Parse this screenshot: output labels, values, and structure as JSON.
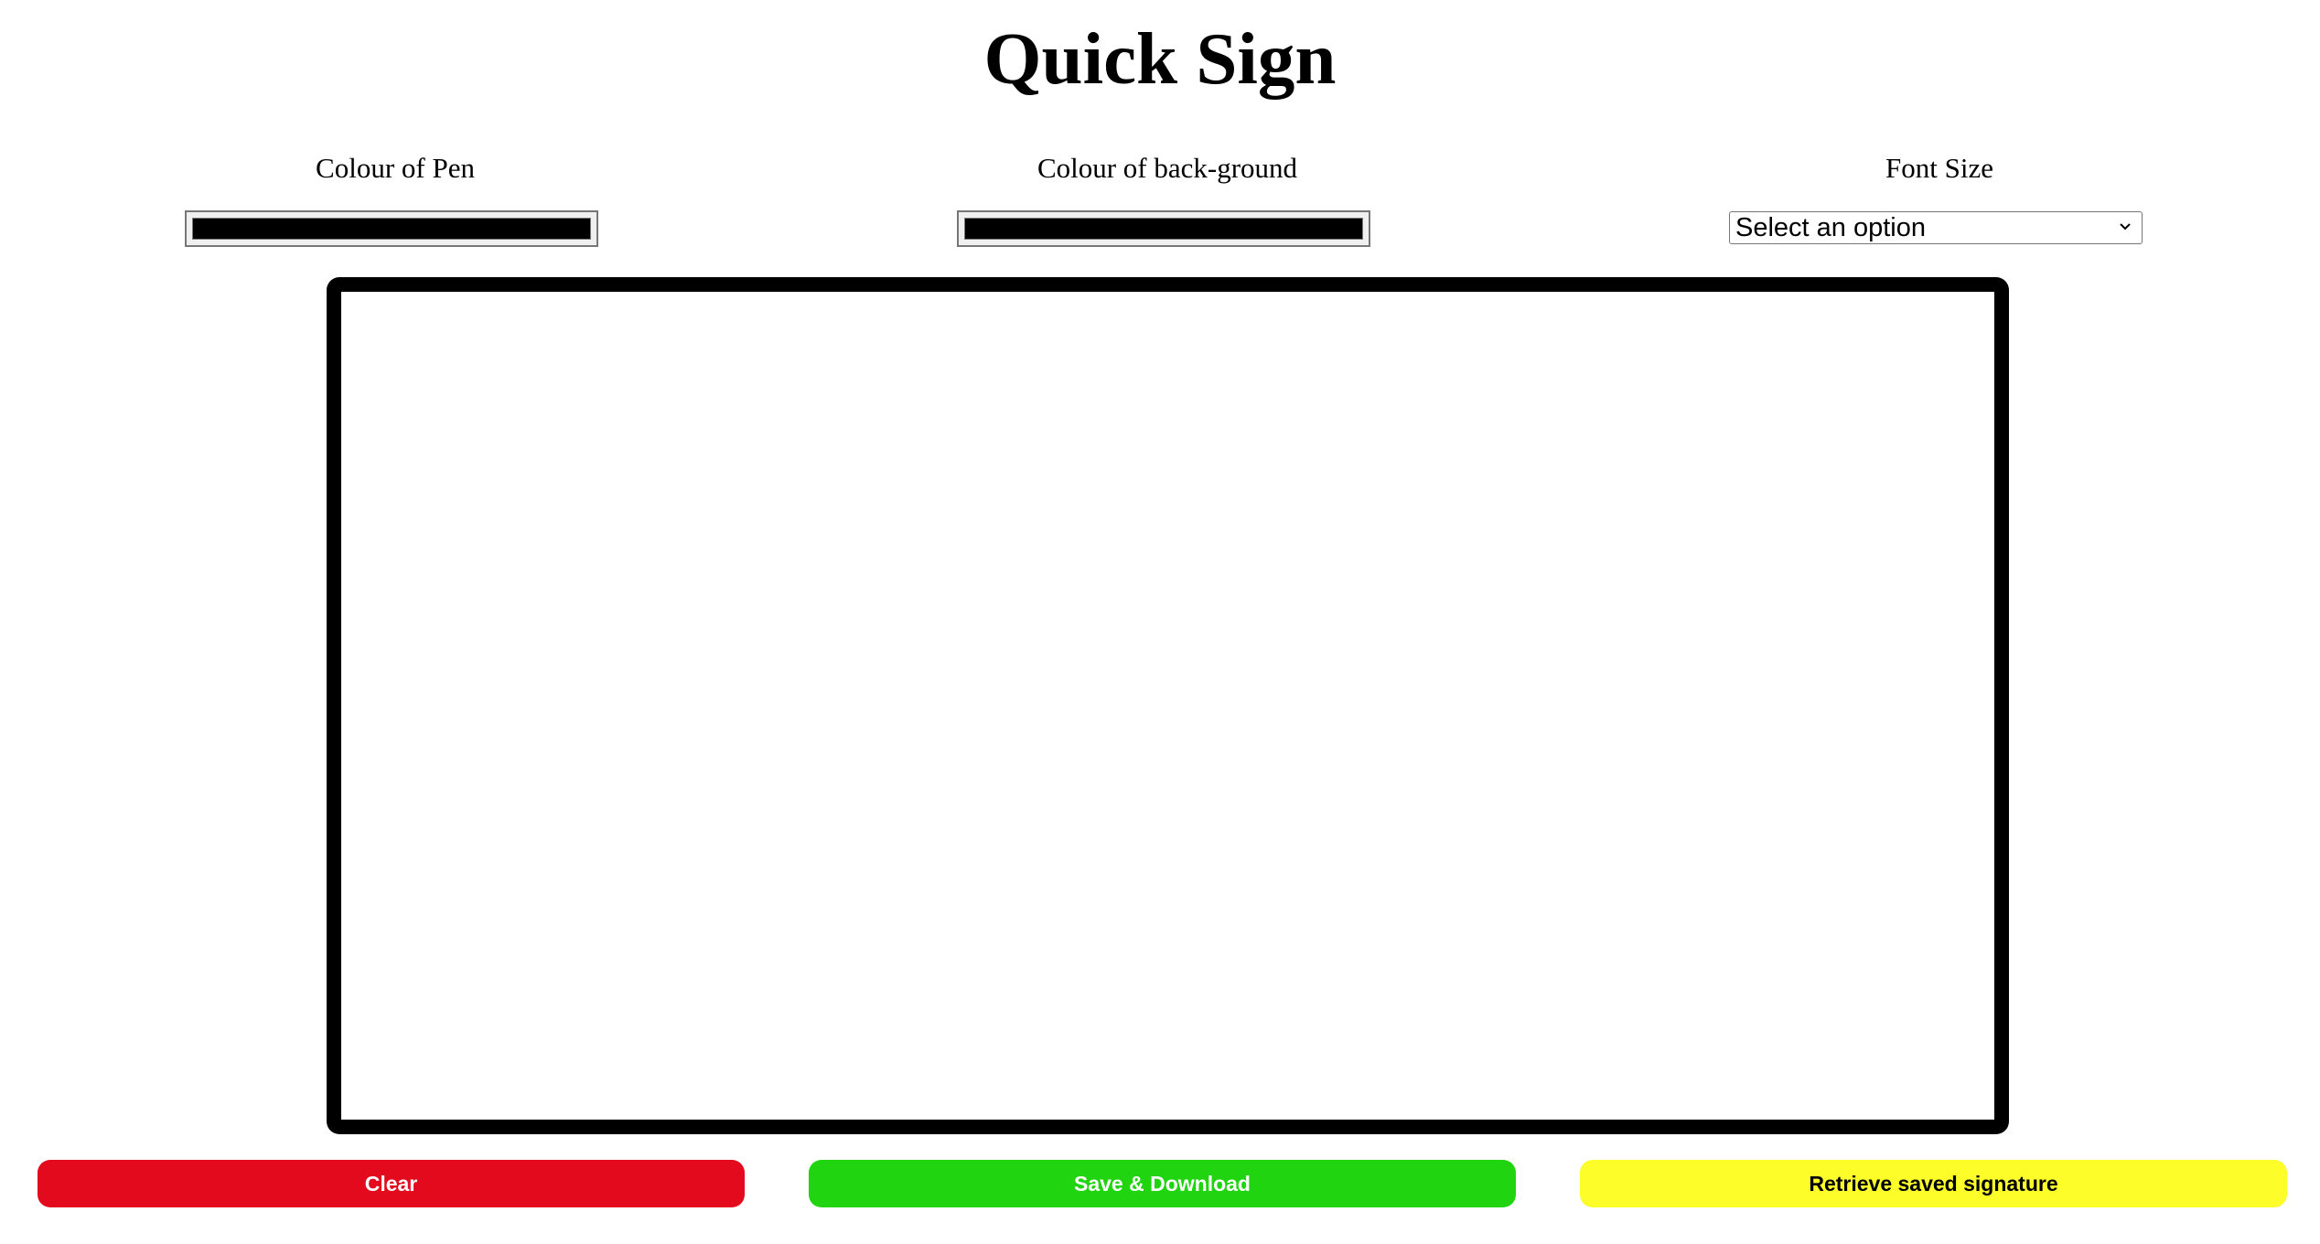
{
  "header": {
    "title": "Quick Sign"
  },
  "controls": {
    "pen_color": {
      "label": "Colour of Pen",
      "value": "#000000"
    },
    "background_color": {
      "label": "Colour of back-ground",
      "value": "#000000"
    },
    "font_size": {
      "label": "Font Size",
      "selected": "Select an option"
    }
  },
  "actions": {
    "clear": {
      "label": "Clear",
      "color": "#e30a1e"
    },
    "save": {
      "label": "Save & Download",
      "color": "#20d410"
    },
    "retrieve": {
      "label": "Retrieve saved signature",
      "color": "#fdfd2a"
    }
  },
  "icons": {
    "dropdown": "chevron-down-icon"
  }
}
